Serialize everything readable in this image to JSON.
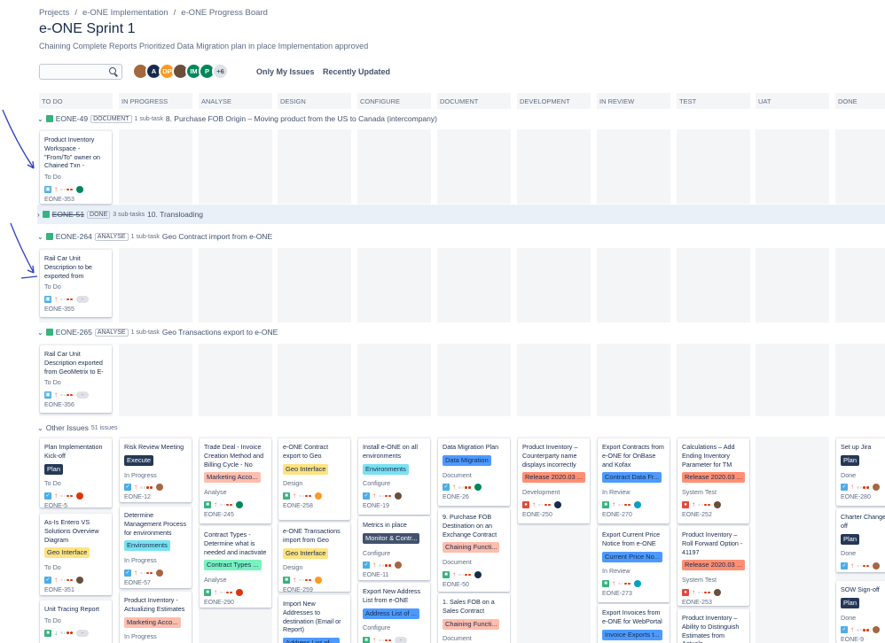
{
  "breadcrumb": [
    "Projects",
    "e-ONE Implementation",
    "e-ONE Progress Board"
  ],
  "board_title": "e-ONE Sprint 1",
  "sprint_goal": "Chaining Complete Reports Prioritized Data Migration plan in place Implementation approved",
  "search": {
    "placeholder": ""
  },
  "avatars": [
    {
      "label": "",
      "color": "#a5673f"
    },
    {
      "label": "A",
      "color": "#172b4d"
    },
    {
      "label": "DP",
      "color": "#ff991f"
    },
    {
      "label": "",
      "color": "#6b4f3a"
    },
    {
      "label": "IM",
      "color": "#00875a"
    },
    {
      "label": "P",
      "color": "#00875a"
    },
    {
      "label": "+6",
      "color": "#dfe1e6"
    }
  ],
  "filters": {
    "only_my": "Only My Issues",
    "recent": "Recently Updated"
  },
  "columns": [
    "TO DO",
    "IN PROGRESS",
    "ANALYSE",
    "DESIGN",
    "CONFIGURE",
    "DOCUMENT",
    "DEVELOPMENT",
    "IN REVIEW",
    "TEST",
    "UAT",
    "DONE"
  ],
  "swimlanes": [
    {
      "key": "EONE-49",
      "status": "DOCUMENT",
      "subtasks": "1 sub-task",
      "title": "8. Purchase FOB Origin – Moving product from the US to Canada (intercompany)"
    },
    {
      "key": "EONE-51",
      "status": "DONE",
      "subtasks": "3 sub-tasks",
      "title": "10. Transloading"
    },
    {
      "key": "EONE-264",
      "status": "ANALYSE",
      "subtasks": "1 sub-task",
      "title": "Geo Contract import from e-ONE"
    },
    {
      "key": "EONE-265",
      "status": "ANALYSE",
      "subtasks": "1 sub-task",
      "title": "Geo Transactions export to e-ONE"
    },
    {
      "key": "",
      "status": "",
      "subtasks": "51 issues",
      "title": "Other Issues"
    }
  ],
  "colors": {
    "story": "#36b37e",
    "subtask": "#4bade8",
    "task": "#4bade8",
    "bug": "#e5493a",
    "priority_high": "#ff5630",
    "priority_low": "#36b37e",
    "chip_dark": "#42526e",
    "chip_blue": "#4c9aff",
    "chip_teal": "#79e2f2",
    "chip_yellow": "#ffe380",
    "chip_red": "#ff8f73",
    "chip_green": "#79f2c0",
    "chip_purple": "#c0b6f2",
    "chip_salmon": "#ffbdad"
  },
  "cards": [
    {
      "id": "c1",
      "title": "Product Inventory Workspace - \"From/To\" owner on Chained Txn -",
      "chip": "",
      "chipColor": "",
      "status": "To Do",
      "type": "subtask",
      "prio": "up",
      "key": "EONE-353",
      "avatar": "#00875a"
    },
    {
      "id": "c2",
      "title": "Rail Car Unit Description to be exported from",
      "chip": "",
      "chipColor": "",
      "status": "To Do",
      "type": "subtask",
      "prio": "up",
      "key": "EONE-355",
      "avatar": ""
    },
    {
      "id": "c3",
      "title": "Rail Car Unit Description exported from GeoMetrix to E-",
      "chip": "",
      "chipColor": "",
      "status": "To Do",
      "type": "subtask",
      "prio": "up",
      "key": "EONE-356",
      "avatar": ""
    },
    {
      "id": "t1",
      "title": "Plan Implementation Kick-off",
      "chip": "Plan",
      "chipColor": "#253858",
      "status": "To Do",
      "type": "task",
      "prio": "up",
      "key": "EONE-5",
      "avatar": "#de350b"
    },
    {
      "id": "t2",
      "title": "As-Is Entero VS Solutions Overview Diagram",
      "chip": "Geo Interface",
      "chipColor": "#ffe380",
      "status": "To Do",
      "type": "task",
      "prio": "up",
      "key": "EONE-351",
      "avatar": "#6b4f3a"
    },
    {
      "id": "t3",
      "title": "Unit Tracing Report",
      "chip": "",
      "chipColor": "",
      "status": "To Do",
      "type": "story",
      "prio": "down",
      "key": "",
      "avatar": ""
    },
    {
      "id": "p1",
      "title": "Risk Review Meeting",
      "chip": "Execute",
      "chipColor": "#253858",
      "status": "In Progress",
      "type": "task",
      "prio": "up",
      "key": "EONE-12",
      "avatar": "#a5673f"
    },
    {
      "id": "p2",
      "title": "Determine Management Process for environments",
      "chip": "Environments",
      "chipColor": "#79e2f2",
      "status": "In Progress",
      "type": "task",
      "prio": "up",
      "key": "EONE-57",
      "avatar": "#a5673f"
    },
    {
      "id": "p3",
      "title": "Product Inventory - Actualizing Estimates",
      "chip": "Marketing Acco...",
      "chipColor": "#ffbdad",
      "status": "In Progress",
      "type": "story",
      "prio": "up",
      "key": "",
      "avatar": ""
    },
    {
      "id": "a1",
      "title": "Trade Deal - Invoice Creation Method and Billing Cycle - No",
      "chip": "Marketing Acco...",
      "chipColor": "#ffbdad",
      "status": "Analyse",
      "type": "story",
      "prio": "up",
      "key": "EONE-245",
      "avatar": "#00875a"
    },
    {
      "id": "a2",
      "title": "Contract Types - Determine what is needed and inactivate",
      "chip": "Contract Types ...",
      "chipColor": "#79f2c0",
      "status": "Analyse",
      "type": "story",
      "prio": "up",
      "key": "EONE-290",
      "avatar": "#de350b"
    },
    {
      "id": "d1",
      "title": "e-ONE Contract export to Geo",
      "chip": "Geo Interface",
      "chipColor": "#ffe380",
      "status": "Design",
      "type": "story",
      "prio": "up",
      "key": "EONE-258",
      "avatar": "#ff991f"
    },
    {
      "id": "d2",
      "title": "e-ONE Transactions import from Geo",
      "chip": "Geo Interface",
      "chipColor": "#ffe380",
      "status": "Design",
      "type": "story",
      "prio": "up",
      "key": "EONE-259",
      "avatar": "#ff991f"
    },
    {
      "id": "d3",
      "title": "Import New Addresses to destination (Email or Report)",
      "chip": "Address List of ...",
      "chipColor": "#4c9aff",
      "status": "",
      "type": "story",
      "prio": "up",
      "key": "",
      "avatar": ""
    },
    {
      "id": "g1",
      "title": "Install e-ONE on all environments",
      "chip": "Environments",
      "chipColor": "#79e2f2",
      "status": "Configure",
      "type": "task",
      "prio": "up",
      "key": "EONE-19",
      "avatar": "#6b4f3a"
    },
    {
      "id": "g2",
      "title": "Metrics in place",
      "chip": "Monitor & Contr...",
      "chipColor": "#42526e",
      "status": "Configure",
      "type": "task",
      "prio": "up",
      "key": "EONE-11",
      "avatar": "#a5673f"
    },
    {
      "id": "g3",
      "title": "Export New Address List from e-ONE",
      "chip": "Address List of ...",
      "chipColor": "#4c9aff",
      "status": "Configure",
      "type": "story",
      "prio": "up",
      "key": "",
      "avatar": ""
    },
    {
      "id": "o1",
      "title": "Data Migration Plan",
      "chip": "Data Migration",
      "chipColor": "#4c9aff",
      "status": "Document",
      "type": "task",
      "prio": "up",
      "key": "EONE-26",
      "avatar": "#00875a"
    },
    {
      "id": "o2",
      "title": "9. Purchase FOB Destination on an Exchange Contract",
      "chip": "Chaining Functi...",
      "chipColor": "#ffbdad",
      "status": "Document",
      "type": "story",
      "prio": "up",
      "key": "EONE-50",
      "avatar": "#172b4d"
    },
    {
      "id": "o3",
      "title": "1. Sales FOB on a Sales Contract",
      "chip": "Chaining Functi...",
      "chipColor": "#ffbdad",
      "status": "Document",
      "type": "story",
      "prio": "up",
      "key": "",
      "avatar": ""
    },
    {
      "id": "v1",
      "title": "Product Inventory – Counterparty name displays incorrectly",
      "chip": "Release 2020.03 ...",
      "chipColor": "#ff8f73",
      "status": "Development",
      "type": "bug",
      "prio": "up",
      "key": "EONE-250",
      "avatar": "#172b4d"
    },
    {
      "id": "r1",
      "title": "Export Contracts from e-ONE for OnBase and Kofax",
      "chip": "Contract Data Fr...",
      "chipColor": "#4c9aff",
      "status": "In Review",
      "type": "story",
      "prio": "up",
      "key": "EONE-270",
      "avatar": "#00a3bf"
    },
    {
      "id": "r2",
      "title": "Export Current Price Notice from e-ONE",
      "chip": "Current Price No...",
      "chipColor": "#4c9aff",
      "status": "In Review",
      "type": "story",
      "prio": "up",
      "key": "EONE-273",
      "avatar": "#00a3bf"
    },
    {
      "id": "r3",
      "title": "Export Invoices from e-ONE for WebPortal",
      "chip": "Invoice Exports t...",
      "chipColor": "#4c9aff",
      "status": "In Review",
      "type": "story",
      "prio": "up",
      "key": "",
      "avatar": ""
    },
    {
      "id": "s1",
      "title": "Calculations – Add Ending Inventory Parameter for TM",
      "chip": "Release 2020.03 ...",
      "chipColor": "#ff8f73",
      "status": "System Test",
      "type": "bug",
      "prio": "up",
      "key": "EONE-252",
      "avatar": "#6b4f3a"
    },
    {
      "id": "s2",
      "title": "Product Inventory – Roll Forward Option - 41197",
      "chip": "Release 2020.03 ...",
      "chipColor": "#ff8f73",
      "status": "System Test",
      "type": "bug",
      "prio": "up",
      "key": "EONE-253",
      "avatar": "#6b4f3a"
    },
    {
      "id": "s3",
      "title": "Product Inventory – Ability to Distinguish Estimates from Actuals",
      "chip": "",
      "chipColor": "",
      "status": "",
      "type": "story",
      "prio": "up",
      "key": "",
      "avatar": ""
    },
    {
      "id": "n1",
      "title": "Set up Jira",
      "chip": "Plan",
      "chipColor": "#253858",
      "status": "Done",
      "type": "task",
      "prio": "up",
      "key": "EONE-280",
      "avatar": "#a5673f"
    },
    {
      "id": "n2",
      "title": "Charter Change Sign-off",
      "chip": "Plan",
      "chipColor": "#253858",
      "status": "Done",
      "type": "task",
      "prio": "up",
      "key": "EONE-10",
      "avatar": "#a5673f"
    },
    {
      "id": "n3",
      "title": "SOW Sign-off",
      "chip": "Plan",
      "chipColor": "#253858",
      "status": "Done",
      "type": "task",
      "prio": "up",
      "key": "EONE-9",
      "avatar": "#a5673f"
    }
  ]
}
